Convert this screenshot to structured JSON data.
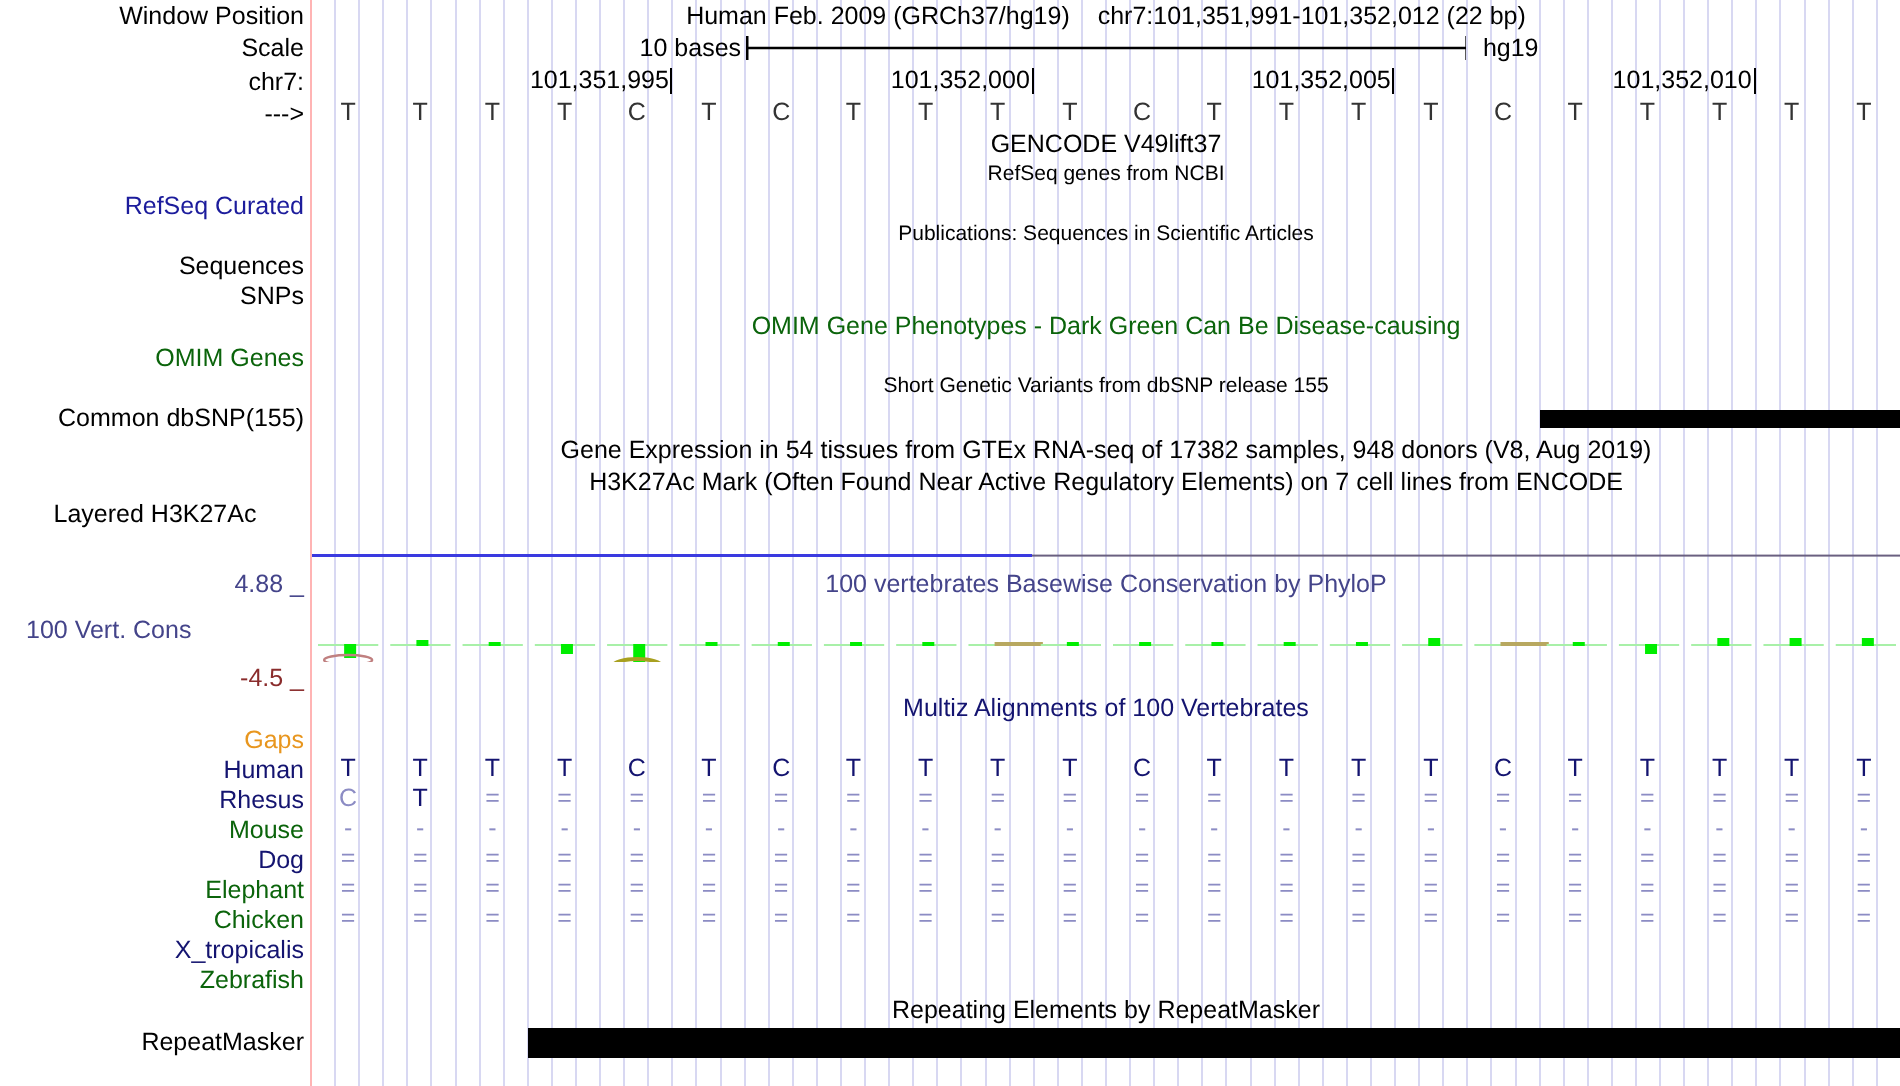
{
  "rows": [
    {
      "kind": "position",
      "label": "Window Position",
      "assembly": "Human Feb. 2009 (GRCh37/hg19)",
      "range": "chr7:101,351,991-101,352,012 (22 bp)"
    },
    {
      "kind": "scale",
      "label": "Scale",
      "span": "10 bases",
      "db": "hg19"
    },
    {
      "kind": "ruler",
      "label": "chr7:",
      "ticks": [
        "101,351,995",
        "101,352,000",
        "101,352,005",
        "101,352,010"
      ]
    },
    {
      "kind": "bases",
      "label": "--->",
      "bases": [
        "T",
        "T",
        "T",
        "T",
        "C",
        "T",
        "C",
        "T",
        "T",
        "T",
        "T",
        "C",
        "T",
        "T",
        "T",
        "T",
        "C",
        "T",
        "T",
        "T",
        "T",
        "T"
      ]
    },
    {
      "kind": "title",
      "title": "GENCODE V49lift37",
      "color": "#000000"
    },
    {
      "kind": "subtitle",
      "title": "RefSeq genes from NCBI"
    },
    {
      "kind": "label",
      "label": "RefSeq Curated",
      "color": "#1c1c9c"
    },
    {
      "kind": "subtitle",
      "title": "Publications: Sequences in Scientific Articles"
    },
    {
      "kind": "label",
      "label": "Sequences",
      "color": "#000000"
    },
    {
      "kind": "label",
      "label": "SNPs",
      "color": "#000000"
    },
    {
      "kind": "title",
      "title": "OMIM Gene Phenotypes - Dark Green Can Be Disease-causing",
      "color": "#0b640b"
    },
    {
      "kind": "label",
      "label": "OMIM Genes",
      "color": "#0b640b"
    },
    {
      "kind": "subtitle",
      "title": "Short Genetic Variants from dbSNP release 155"
    },
    {
      "kind": "snp_track",
      "label": "Common dbSNP(155)",
      "color": "#000000",
      "covered": [
        false,
        false,
        false,
        false,
        false,
        false,
        false,
        false,
        false,
        false,
        false,
        false,
        false,
        false,
        false,
        false,
        false,
        true,
        true,
        true,
        true,
        true
      ]
    },
    {
      "kind": "title",
      "title": "Gene Expression in 54 tissues from GTEx RNA-seq of 17382 samples, 948 donors (V8, Aug 2019)",
      "color": "#000000"
    },
    {
      "kind": "title",
      "title": "H3K27Ac Mark (Often Found Near Active Regulatory Elements) on 7 cell lines from ENCODE",
      "color": "#000000"
    },
    {
      "kind": "composite_label",
      "label": "Layered H3K27Ac",
      "color": "#000000"
    },
    {
      "kind": "signal"
    },
    {
      "kind": "axis",
      "label": "4.88 _",
      "color": "#44448a",
      "title": "100 vertebrates Basewise Conservation by PhyloP"
    },
    {
      "kind": "conservation",
      "label": "100 Vert. Cons",
      "color": "#44448a"
    },
    {
      "kind": "axis",
      "label": "-4.5 _",
      "color": "#8a2c2c"
    },
    {
      "kind": "title",
      "title": "Multiz Alignments of 100 Vertebrates",
      "color": "#141470"
    },
    {
      "kind": "label",
      "label": "Gaps",
      "color": "#e8961e"
    },
    {
      "kind": "species",
      "label": "Human",
      "color": "#141470",
      "bases": [
        "T",
        "T",
        "T",
        "T",
        "C",
        "T",
        "C",
        "T",
        "T",
        "T",
        "T",
        "C",
        "T",
        "T",
        "T",
        "T",
        "C",
        "T",
        "T",
        "T",
        "T",
        "T"
      ],
      "dim": [
        false,
        false,
        false,
        false,
        false,
        false,
        false,
        false,
        false,
        false,
        false,
        false,
        false,
        false,
        false,
        false,
        false,
        false,
        false,
        false,
        false,
        false
      ]
    },
    {
      "kind": "species",
      "label": "Rhesus",
      "color": "#141470",
      "bases": [
        "C",
        "T",
        "=",
        "=",
        "=",
        "=",
        "=",
        "=",
        "=",
        "=",
        "=",
        "=",
        "=",
        "=",
        "=",
        "=",
        "=",
        "=",
        "=",
        "=",
        "=",
        "="
      ],
      "dim": [
        true,
        false,
        true,
        true,
        true,
        true,
        true,
        true,
        true,
        true,
        true,
        true,
        true,
        true,
        true,
        true,
        true,
        true,
        true,
        true,
        true,
        true
      ]
    },
    {
      "kind": "species",
      "label": "Mouse",
      "color": "#0b640b",
      "bases": [
        "-",
        "-",
        "-",
        "-",
        "-",
        "-",
        "-",
        "-",
        "-",
        "-",
        "-",
        "-",
        "-",
        "-",
        "-",
        "-",
        "-",
        "-",
        "-",
        "-",
        "-",
        "-"
      ],
      "dim": [
        true,
        true,
        true,
        true,
        true,
        true,
        true,
        true,
        true,
        true,
        true,
        true,
        true,
        true,
        true,
        true,
        true,
        true,
        true,
        true,
        true,
        true
      ]
    },
    {
      "kind": "species",
      "label": "Dog",
      "color": "#141470",
      "bases": [
        "=",
        "=",
        "=",
        "=",
        "=",
        "=",
        "=",
        "=",
        "=",
        "=",
        "=",
        "=",
        "=",
        "=",
        "=",
        "=",
        "=",
        "=",
        "=",
        "=",
        "=",
        "="
      ],
      "dim": [
        true,
        true,
        true,
        true,
        true,
        true,
        true,
        true,
        true,
        true,
        true,
        true,
        true,
        true,
        true,
        true,
        true,
        true,
        true,
        true,
        true,
        true
      ]
    },
    {
      "kind": "species",
      "label": "Elephant",
      "color": "#0b640b",
      "bases": [
        "=",
        "=",
        "=",
        "=",
        "=",
        "=",
        "=",
        "=",
        "=",
        "=",
        "=",
        "=",
        "=",
        "=",
        "=",
        "=",
        "=",
        "=",
        "=",
        "=",
        "=",
        "="
      ],
      "dim": [
        true,
        true,
        true,
        true,
        true,
        true,
        true,
        true,
        true,
        true,
        true,
        true,
        true,
        true,
        true,
        true,
        true,
        true,
        true,
        true,
        true,
        true
      ]
    },
    {
      "kind": "species",
      "label": "Chicken",
      "color": "#0b640b",
      "bases": [
        "=",
        "=",
        "=",
        "=",
        "=",
        "=",
        "=",
        "=",
        "=",
        "=",
        "=",
        "=",
        "=",
        "=",
        "=",
        "=",
        "=",
        "=",
        "=",
        "=",
        "=",
        "="
      ],
      "dim": [
        true,
        true,
        true,
        true,
        true,
        true,
        true,
        true,
        true,
        true,
        true,
        true,
        true,
        true,
        true,
        true,
        true,
        true,
        true,
        true,
        true,
        true
      ]
    },
    {
      "kind": "species",
      "label": "X_tropicalis",
      "color": "#141470"
    },
    {
      "kind": "species",
      "label": "Zebrafish",
      "color": "#0b640b"
    },
    {
      "kind": "title",
      "title": "Repeating Elements by RepeatMasker",
      "color": "#000000"
    },
    {
      "kind": "repeat_track",
      "label": "RepeatMasker",
      "color": "#000000",
      "covered": [
        false,
        false,
        false,
        true,
        true,
        true,
        true,
        true,
        true,
        true,
        true,
        true,
        true,
        true,
        true,
        true,
        true,
        true,
        true,
        true,
        true,
        true
      ]
    }
  ]
}
